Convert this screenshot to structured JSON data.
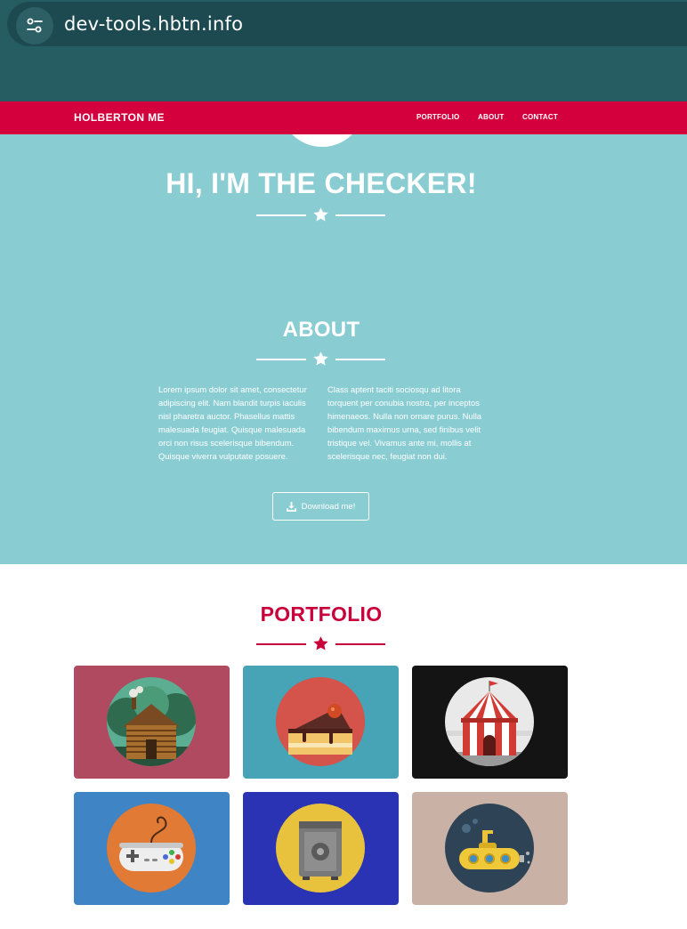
{
  "browser": {
    "url": "dev-tools.hbtn.info",
    "site_info_icon": "tune-icon"
  },
  "nav": {
    "brand": "HOLBERTON ME",
    "links": [
      "PORTFOLIO",
      "ABOUT",
      "CONTACT"
    ]
  },
  "hero": {
    "title": "HI, I'M THE CHECKER!",
    "divider_icon": "star-icon"
  },
  "about": {
    "title": "ABOUT",
    "col1": "Lorem ipsum dolor sit amet, consectetur adipiscing elit. Nam blandit turpis iaculis nisl pharetra auctor. Phasellus mattis malesuada feugiat. Quisque malesuada orci non risus scelerisque bibendum. Quisque viverra vulputate posuere.",
    "col2": "Class aptent taciti sociosqu ad litora torquent per conubia nostra, per inceptos himenaeos. Nulla non ornare purus. Nulla bibendum maximus urna, sed finibus velit tristique vel. Vivamus ante mi, mollis at scelerisque nec, feugiat non dui.",
    "download_label": "Download me!",
    "download_icon": "download-icon"
  },
  "portfolio": {
    "title": "PORTFOLIO",
    "items": [
      {
        "name": "cabin",
        "bg": "#b04a61"
      },
      {
        "name": "cake",
        "bg": "#47a4b6"
      },
      {
        "name": "circus-tent",
        "bg": "#141414"
      },
      {
        "name": "game-controller",
        "bg": "#3f84c5"
      },
      {
        "name": "safe",
        "bg": "#2933b4"
      },
      {
        "name": "submarine",
        "bg": "#c9b2a5"
      }
    ]
  },
  "colors": {
    "accent": "#d3003d",
    "hero_bg": "#89cdd3",
    "browser_bar": "#265d63"
  }
}
